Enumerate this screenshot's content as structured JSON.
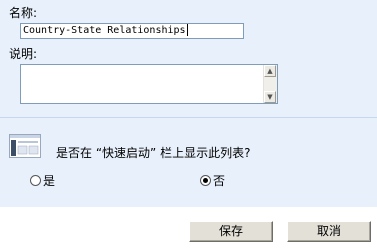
{
  "form": {
    "name_label": "名称:",
    "name_value": "Country-State Relationships",
    "description_label": "说明:",
    "description_value": ""
  },
  "quick_launch": {
    "question": "是否在 “快速启动” 栏上显示此列表?",
    "options": [
      {
        "label": "是",
        "selected": false
      },
      {
        "label": "否",
        "selected": true
      }
    ]
  },
  "scrollbar": {
    "up_glyph": "▲",
    "down_glyph": "▼"
  },
  "buttons": {
    "save_label": "保存",
    "cancel_label": "取消"
  },
  "icons": {
    "list_icon": "list-view-icon"
  },
  "colors": {
    "panel_background": "#e8f0fb",
    "input_border": "#7f9db9",
    "button_face": "#e3e0d8"
  }
}
